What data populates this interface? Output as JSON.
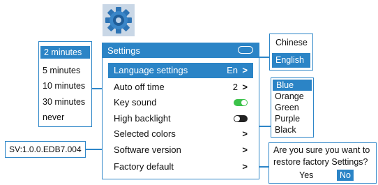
{
  "settings": {
    "title": "Settings",
    "rows": [
      {
        "label": "Language settings",
        "value": "En",
        "chevron": ">"
      },
      {
        "label": "Auto off time",
        "value": "2",
        "chevron": ">"
      },
      {
        "label": "Key sound",
        "toggle": "on"
      },
      {
        "label": "High backlight",
        "toggle": "off"
      },
      {
        "label": "Selected colors",
        "chevron": ">"
      },
      {
        "label": "Software version",
        "chevron": ">"
      },
      {
        "label": "Factory default",
        "chevron": ">"
      }
    ]
  },
  "auto_off": {
    "options": [
      "2 minutes",
      "5 minutes",
      "10 minutes",
      "30 minutes",
      "never"
    ],
    "selected": "2 minutes"
  },
  "language": {
    "options": [
      "Chinese",
      "English"
    ],
    "selected": "English"
  },
  "colors": {
    "options": [
      "Blue",
      "Orange",
      "Green",
      "Purple",
      "Black"
    ],
    "selected": "Blue"
  },
  "software_version": "SV:1.0.0.EDB7.004",
  "factory_reset_dialog": {
    "question": "Are you sure you want to restore factory Settings?",
    "line1": "Are you sure you want to",
    "line2": "restore factory Settings?",
    "yes": "Yes",
    "no": "No"
  },
  "icons": {
    "settings_gear": "gear-icon",
    "battery": "battery-icon"
  },
  "colors_theme": {
    "accent": "#2b84c6",
    "toggle_on": "#3cc24a",
    "toggle_off": "#222222"
  }
}
